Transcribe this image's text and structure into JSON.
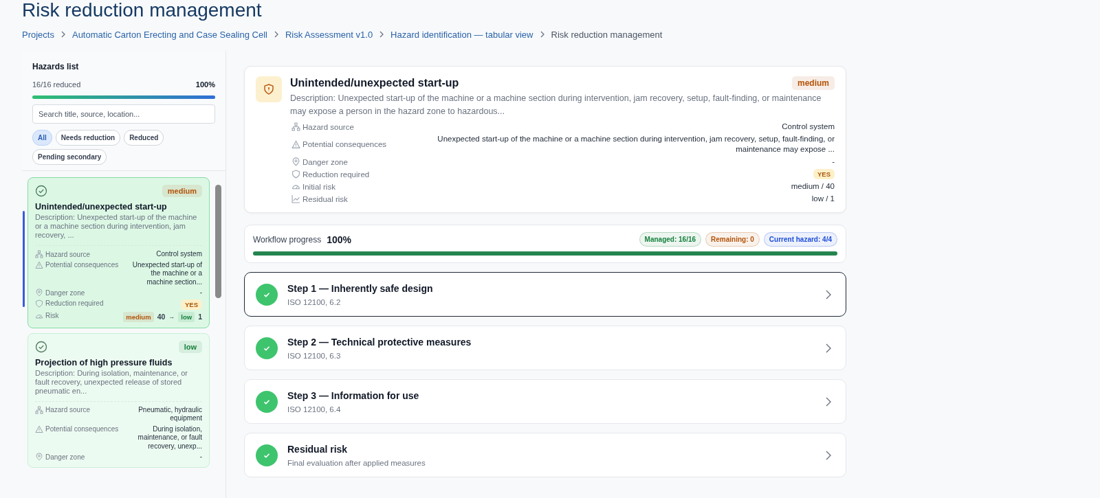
{
  "page_title": "Risk reduction management",
  "breadcrumbs": [
    {
      "label": "Projects",
      "current": false
    },
    {
      "label": "Automatic Carton Erecting and Case Sealing Cell",
      "current": false
    },
    {
      "label": "Risk Assessment v1.0",
      "current": false
    },
    {
      "label": "Hazard identification — tabular view",
      "current": false
    },
    {
      "label": "Risk reduction management",
      "current": true
    }
  ],
  "hazards_list": {
    "title": "Hazards list",
    "summary": "16/16 reduced",
    "percent": "100%",
    "level": 1,
    "search": {
      "placeholder": "Search title, source, location..."
    },
    "filters": [
      {
        "label": "All",
        "selected": true
      },
      {
        "label": "Needs reduction",
        "selected": false
      },
      {
        "label": "Reduced",
        "selected": false
      },
      {
        "label": "Pending secondary",
        "selected": false
      }
    ],
    "items": [
      {
        "selected": true,
        "reduced": true,
        "severity": {
          "text": "medium",
          "color": "#b45309"
        },
        "title": "Unintended/unexpected start-up",
        "description": "Description: Unexpected start-up of the machine or a machine section during intervention, jam recovery, ...",
        "fields": [
          {
            "kind": "text",
            "label": "Hazard source",
            "value": "Control system"
          },
          {
            "kind": "text",
            "label": "Potential consequences",
            "value": "Unexpected start-up of the machine or a machine section..."
          },
          {
            "kind": "text",
            "label": "Danger zone",
            "value": "-"
          },
          {
            "kind": "badge",
            "label": "Reduction required",
            "value": "YES"
          }
        ],
        "risk": {
          "label": "Risk",
          "initial": {
            "text": "medium",
            "color": "#b45309"
          },
          "initial_score": "40",
          "arrow": "→",
          "residual": {
            "text": "low",
            "color": "#15803d"
          },
          "residual_score": "1"
        }
      },
      {
        "selected": false,
        "reduced": true,
        "severity": {
          "text": "low",
          "color": "#15803d"
        },
        "title": "Projection of high pressure fluids",
        "description": "Description: During isolation, maintenance, or fault recovery, unexpected release of stored pneumatic en...",
        "fields": [
          {
            "kind": "text",
            "label": "Hazard source",
            "value": "Pneumatic, hydraulic equipment"
          },
          {
            "kind": "text",
            "label": "Potential consequences",
            "value": "During isolation, maintenance, or fault recovery, unexp..."
          },
          {
            "kind": "text",
            "label": "Danger zone",
            "value": "-"
          }
        ]
      }
    ]
  },
  "hazard_detail": {
    "title": "Unintended/unexpected start-up",
    "severity": {
      "text": "medium",
      "color": "#b45309"
    },
    "description": "Description: Unexpected start-up of the machine or a machine section during intervention, jam recovery, setup, fault-finding, or maintenance may expose a person in the hazard zone to hazardous...",
    "fields": [
      {
        "kind": "text",
        "label": "Hazard source",
        "value": "Control system"
      },
      {
        "kind": "text",
        "label": "Potential consequences",
        "value": "Unexpected start-up of the machine or a machine section during intervention, jam recovery, setup, fault-finding, or maintenance may expose ..."
      },
      {
        "kind": "text",
        "label": "Danger zone",
        "value": "-"
      },
      {
        "kind": "badge",
        "label": "Reduction required",
        "value": "YES"
      },
      {
        "kind": "text",
        "label": "Initial risk",
        "value": "medium / 40"
      },
      {
        "kind": "text",
        "label": "Residual risk",
        "value": "low / 1"
      }
    ]
  },
  "workflow": {
    "label": "Workflow progress",
    "percent": "100%",
    "level": 1,
    "chips": [
      {
        "text": "Managed: 16/16",
        "color": "#15803d"
      },
      {
        "text": "Remaining: 0",
        "color": "#b45309"
      },
      {
        "text": "Current hazard: 4/4",
        "color": "#1d4ed8"
      }
    ]
  },
  "steps": [
    {
      "title": "Step 1 — Inherently safe design",
      "subtitle": "ISO 12100, 6.2",
      "done": true,
      "selected": true
    },
    {
      "title": "Step 2 — Technical protective measures",
      "subtitle": "ISO 12100, 6.3",
      "done": true,
      "selected": false
    },
    {
      "title": "Step 3 — Information for use",
      "subtitle": "ISO 12100, 6.4",
      "done": true,
      "selected": false
    },
    {
      "title": "Residual risk",
      "subtitle": "Final evaluation after applied measures",
      "done": true,
      "selected": false
    }
  ]
}
